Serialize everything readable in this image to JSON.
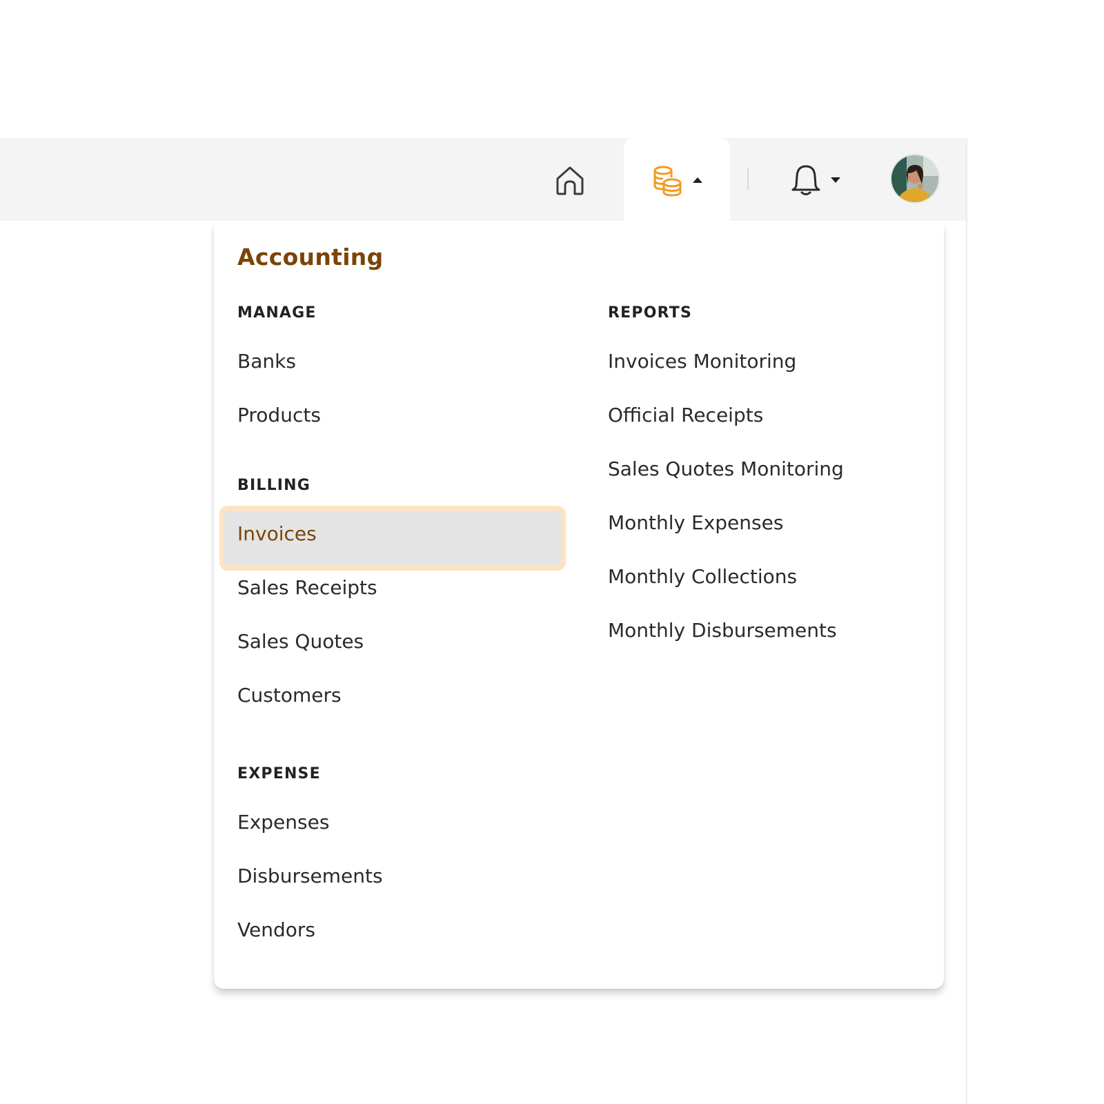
{
  "nav": {
    "home_icon": "home-icon",
    "accounting_icon": "coins-icon",
    "notifications_icon": "bell-icon",
    "accent_color": "#f29a1f"
  },
  "dropdown": {
    "title": "Accounting",
    "title_color": "#7a4408",
    "sections_left": [
      {
        "heading": "MANAGE",
        "items": [
          "Banks",
          "Products"
        ]
      },
      {
        "heading": "BILLING",
        "items": [
          "Invoices",
          "Sales Receipts",
          "Sales Quotes",
          "Customers"
        ]
      },
      {
        "heading": "EXPENSE",
        "items": [
          "Expenses",
          "Disbursements",
          "Vendors"
        ]
      }
    ],
    "sections_right": [
      {
        "heading": "REPORTS",
        "items": [
          "Invoices Monitoring",
          "Official Receipts",
          "Sales Quotes Monitoring",
          "Monthly Expenses",
          "Monthly Collections",
          "Monthly Disbursements"
        ]
      }
    ],
    "active_item": "Invoices",
    "active_highlight_color": "#fde3c2"
  }
}
